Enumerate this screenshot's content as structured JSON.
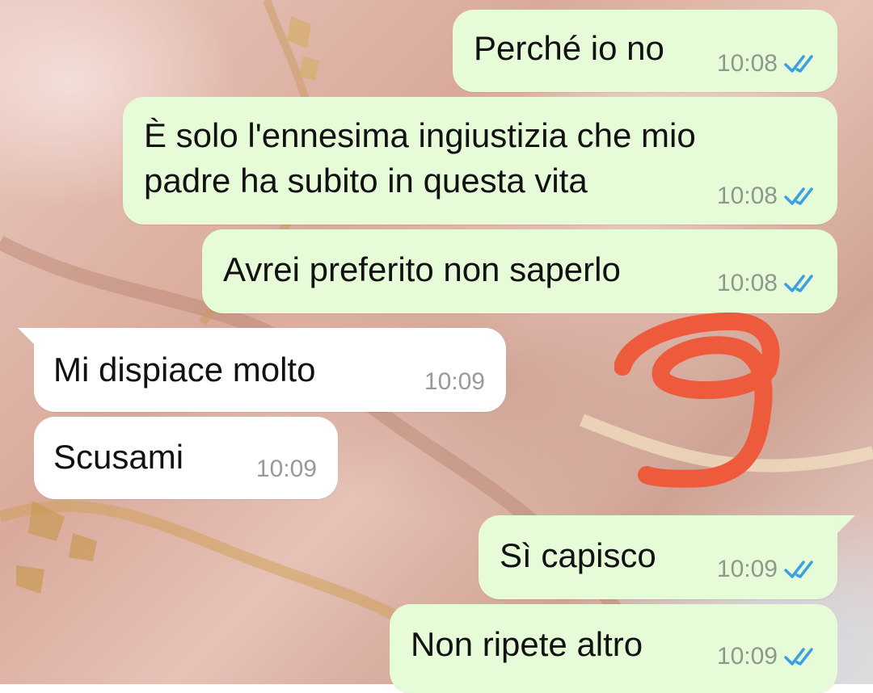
{
  "conversation": {
    "messages": [
      {
        "direction": "outgoing",
        "text": "Perché io no",
        "time": "10:08",
        "status": "read"
      },
      {
        "direction": "outgoing",
        "text": "È solo l'ennesima ingiustizia che mio\npadre ha subito in questa vita",
        "time": "10:08",
        "status": "read"
      },
      {
        "direction": "outgoing",
        "text": "Avrei preferito non saperlo",
        "time": "10:08",
        "status": "read"
      },
      {
        "direction": "incoming",
        "text": "Mi dispiace molto",
        "time": "10:09"
      },
      {
        "direction": "incoming",
        "text": "Scusami",
        "time": "10:09"
      },
      {
        "direction": "outgoing",
        "text": "Sì capisco",
        "time": "10:09",
        "status": "read"
      },
      {
        "direction": "outgoing",
        "text": "Non ripete altro",
        "time": "10:09",
        "status": "read"
      }
    ]
  },
  "icons": {
    "read_receipt": "double-check-icon"
  },
  "colors": {
    "outgoing_bubble": "#e6fbd8",
    "incoming_bubble": "#ffffff",
    "read_tick": "#3aa0e0",
    "annotation": "#ee5a3c"
  }
}
